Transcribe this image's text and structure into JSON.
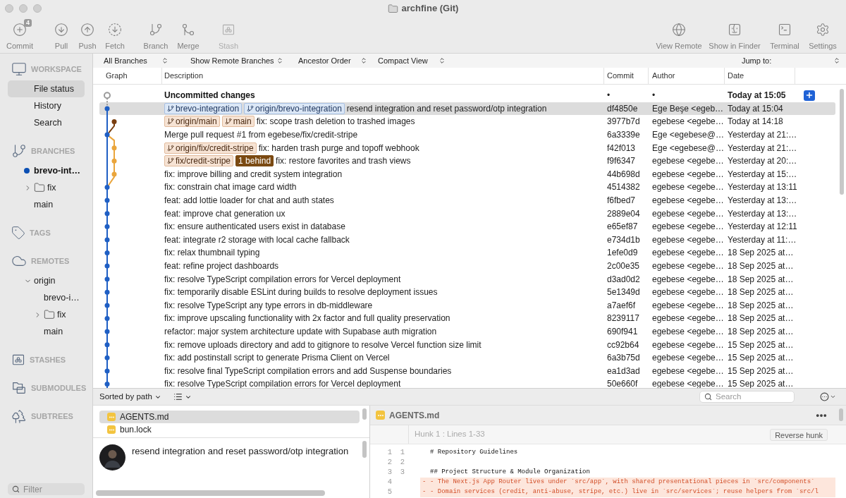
{
  "window": {
    "title": "archfine (Git)"
  },
  "toolbar": {
    "left": [
      {
        "label": "Commit",
        "disabled": false,
        "badge": "4"
      },
      {
        "label": "Pull",
        "disabled": false
      },
      {
        "label": "Push",
        "disabled": false
      },
      {
        "label": "Fetch",
        "disabled": false
      },
      {
        "label": "Branch",
        "disabled": false
      },
      {
        "label": "Merge",
        "disabled": false
      },
      {
        "label": "Stash",
        "disabled": true
      }
    ],
    "right": [
      {
        "label": "View Remote",
        "disabled": false
      },
      {
        "label": "Show in Finder",
        "disabled": false
      },
      {
        "label": "Terminal",
        "disabled": false
      },
      {
        "label": "Settings",
        "disabled": false
      }
    ]
  },
  "sidebar": {
    "sections": [
      {
        "title": "WORKSPACE",
        "items": [
          {
            "label": "File status",
            "kind": "item",
            "selected": true
          },
          {
            "label": "History",
            "kind": "item",
            "selected": false
          },
          {
            "label": "Search",
            "kind": "item",
            "selected": false
          }
        ]
      },
      {
        "title": "BRANCHES",
        "items": [
          {
            "label": "brevo-int…",
            "kind": "branch",
            "current": true,
            "selected": false
          },
          {
            "label": "fix",
            "kind": "folder",
            "expanded": false,
            "selected": false
          },
          {
            "label": "main",
            "kind": "branch",
            "current": false,
            "selected": false
          }
        ]
      },
      {
        "title": "TAGS"
      },
      {
        "title": "REMOTES",
        "items": [
          {
            "label": "origin",
            "kind": "remote",
            "expanded": true,
            "selected": false,
            "children": [
              {
                "label": "brevo-i…",
                "kind": "branch",
                "current": false,
                "selected": false
              },
              {
                "label": "fix",
                "kind": "folder",
                "expanded": false,
                "selected": false
              },
              {
                "label": "main",
                "kind": "branch",
                "current": false,
                "selected": false
              }
            ]
          }
        ]
      },
      {
        "title": "STASHES"
      },
      {
        "title": "SUBMODULES"
      },
      {
        "title": "SUBTREES"
      }
    ],
    "filter": {
      "placeholder": "Filter"
    }
  },
  "filters": [
    "All Branches",
    "Show Remote Branches",
    "Ancestor Order",
    "Compact View",
    "Jump to:"
  ],
  "columns": [
    "Graph",
    "Description",
    "Commit",
    "Author",
    "Date"
  ],
  "commits": [
    {
      "kind": "uncommitted",
      "description": "Uncommitted changes",
      "commit": "•",
      "author": "•",
      "date": "Today at 15:05",
      "selected": false
    },
    {
      "kind": "commit",
      "refs": [
        {
          "label": "brevo-integration",
          "kind": "current"
        },
        {
          "label": "origin/brevo-integration",
          "kind": "current"
        }
      ],
      "description": "resend integration and reset password/otp integration",
      "commit": "df4850e",
      "author": "Ege Beşe <egeb…",
      "date": "Today at 15:04",
      "selected": true
    },
    {
      "kind": "commit",
      "refs": [
        {
          "label": "origin/main",
          "kind": "branch"
        },
        {
          "label": "main",
          "kind": "branch"
        }
      ],
      "description": "fix: scope trash deletion to trashed images",
      "commit": "3977b7d",
      "author": "egebese <egebe…",
      "date": "Today at 14:18",
      "selected": false
    },
    {
      "kind": "commit",
      "description": "Merge pull request #1 from egebese/fix/credit-stripe",
      "commit": "6a3339e",
      "author": "Ege <egebese@…",
      "date": "Yesterday at 21:…",
      "selected": false
    },
    {
      "kind": "commit",
      "refs": [
        {
          "label": "origin/fix/credit-stripe",
          "kind": "branch"
        }
      ],
      "description": "fix: harden trash purge and topoff webhook",
      "commit": "f42f013",
      "author": "Ege <egebese@…",
      "date": "Yesterday at 21:…",
      "selected": false
    },
    {
      "kind": "commit",
      "refs": [
        {
          "label": "fix/credit-stripe",
          "kind": "branch"
        },
        {
          "label": "1 behind",
          "kind": "behind"
        }
      ],
      "description": "fix: restore favorites and trash views",
      "commit": "f9f6347",
      "author": "egebese <egebe…",
      "date": "Yesterday at 20:…",
      "selected": false
    },
    {
      "kind": "commit",
      "description": "fix: improve billing and credit system integration",
      "commit": "44b698d",
      "author": "egebese <egebe…",
      "date": "Yesterday at 15:…",
      "selected": false
    },
    {
      "kind": "commit",
      "description": "fix: constrain chat image card width",
      "commit": "4514382",
      "author": "egebese <egebe…",
      "date": "Yesterday at 13:11",
      "selected": false
    },
    {
      "kind": "commit",
      "description": "feat: add lottie loader for chat and auth states",
      "commit": "f6fbed7",
      "author": "egebese <egebe…",
      "date": "Yesterday at 13:…",
      "selected": false
    },
    {
      "kind": "commit",
      "description": "feat: improve chat generation ux",
      "commit": "2889e04",
      "author": "egebese <egebe…",
      "date": "Yesterday at 13:…",
      "selected": false
    },
    {
      "kind": "commit",
      "description": "fix: ensure authenticated users exist in database",
      "commit": "e65ef87",
      "author": "egebese <egebe…",
      "date": "Yesterday at 12:11",
      "selected": false
    },
    {
      "kind": "commit",
      "description": "feat: integrate r2 storage with local cache fallback",
      "commit": "e734d1b",
      "author": "egebese <egebe…",
      "date": "Yesterday at 11:…",
      "selected": false
    },
    {
      "kind": "commit",
      "description": "fix: relax thumbnail typing",
      "commit": "1efe0d9",
      "author": "egebese <egebe…",
      "date": "18 Sep 2025 at…",
      "selected": false
    },
    {
      "kind": "commit",
      "description": "feat: refine project dashboards",
      "commit": "2c00e35",
      "author": "egebese <egebe…",
      "date": "18 Sep 2025 at…",
      "selected": false
    },
    {
      "kind": "commit",
      "description": "fix: resolve TypeScript compilation errors for Vercel deployment",
      "commit": "d3ad0d2",
      "author": "egebese <egebe…",
      "date": "18 Sep 2025 at…",
      "selected": false
    },
    {
      "kind": "commit",
      "description": "fix: temporarily disable ESLint during builds to resolve deployment issues",
      "commit": "5e1349d",
      "author": "egebese <egebe…",
      "date": "18 Sep 2025 at…",
      "selected": false
    },
    {
      "kind": "commit",
      "description": "fix: resolve TypeScript any type errors in db-middleware",
      "commit": "a7aef6f",
      "author": "egebese <egebe…",
      "date": "18 Sep 2025 at…",
      "selected": false
    },
    {
      "kind": "commit",
      "description": "fix: improve upscaling functionality with 2x factor and full quality preservation",
      "commit": "8239117",
      "author": "egebese <egebe…",
      "date": "18 Sep 2025 at…",
      "selected": false
    },
    {
      "kind": "commit",
      "description": "refactor: major system architecture update with Supabase auth migration",
      "commit": "690f941",
      "author": "egebese <egebe…",
      "date": "18 Sep 2025 at…",
      "selected": false
    },
    {
      "kind": "commit",
      "description": "fix: remove uploads directory and add to gitignore to resolve Vercel function size limit",
      "commit": "cc92b64",
      "author": "egebese <egebe…",
      "date": "15 Sep 2025 at…",
      "selected": false
    },
    {
      "kind": "commit",
      "description": "fix: add postinstall script to generate Prisma Client on Vercel",
      "commit": "6a3b75d",
      "author": "egebese <egebe…",
      "date": "15 Sep 2025 at…",
      "selected": false
    },
    {
      "kind": "commit",
      "description": "fix: resolve final TypeScript compilation errors and add Suspense boundaries",
      "commit": "ea1d3ad",
      "author": "egebese <egebe…",
      "date": "15 Sep 2025 at…",
      "selected": false
    },
    {
      "kind": "commit",
      "description": "fix: resolve TypeScript compilation errors for Vercel deployment",
      "commit": "50e660f",
      "author": "egebese <egebe…",
      "date": "15 Sep 2025 at…",
      "selected": false
    }
  ],
  "files_panel": {
    "sort": "Sorted by path",
    "files": [
      {
        "name": "AGENTS.md",
        "selected": true
      },
      {
        "name": "bun.lock",
        "selected": false
      }
    ]
  },
  "detail": {
    "message": "resend integration and reset password/otp integration"
  },
  "diff": {
    "search_placeholder": "Search",
    "file": "AGENTS.md",
    "hunk": "Hunk 1 : Lines 1-33",
    "reverse": "Reverse hunk",
    "lines": [
      {
        "kind": "context",
        "old": "1",
        "new": "1",
        "text": "# Repository Guidelines"
      },
      {
        "kind": "context",
        "old": "2",
        "new": "2"
      },
      {
        "kind": "context",
        "old": "3",
        "new": "3",
        "text": "## Project Structure & Module Organization"
      },
      {
        "kind": "removed",
        "old": "4",
        "sign": "-",
        "text": "- The Next.js App Router lives under `src/app`, with shared presentational pieces in `src/components`"
      },
      {
        "kind": "removed",
        "old": "5",
        "sign": "-",
        "text": "- Domain services (credit, anti-abuse, stripe, etc.) live in `src/services`; reuse helpers from `src/l"
      }
    ]
  }
}
